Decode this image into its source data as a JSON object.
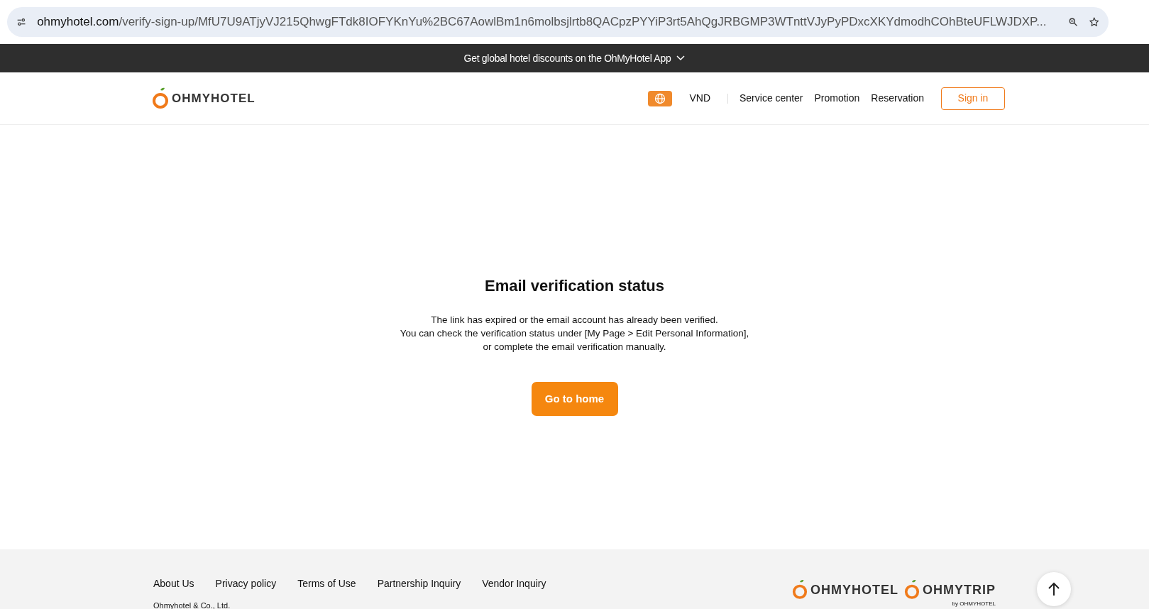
{
  "browser": {
    "url_host": "ohmyhotel.com",
    "url_path": "/verify-sign-up/MfU7U9ATjyVJ215QhwgFTdk8IOFYKnYu%2BC67AowlBm1n6molbsjlrtb8QACpzPYYiP3rt5AhQgJRBGMP3WTnttVJyPyPDxcXKYdmodhCOhBteUFLWJDXP..."
  },
  "promo_banner": {
    "text": "Get global hotel discounts on the OhMyHotel App"
  },
  "header": {
    "logo": "OHMYHOTEL",
    "currency": "VND",
    "nav": [
      "Service center",
      "Promotion",
      "Reservation"
    ],
    "sign_in": "Sign in"
  },
  "main": {
    "title": "Email verification status",
    "message_lines": [
      "The link has expired or the email account has already been verified.",
      "You can check the verification status under [My Page > Edit Personal Information],",
      "or complete the email verification manually."
    ],
    "button": "Go to home"
  },
  "footer": {
    "links": [
      "About Us",
      "Privacy policy",
      "Terms of Use",
      "Partnership Inquiry",
      "Vendor Inquiry"
    ],
    "company": "Ohmyhotel & Co., Ltd.",
    "logos": [
      {
        "name": "OHMYHOTEL"
      },
      {
        "name": "OHMYTRIP",
        "byline": "by OHMYHOTEL"
      }
    ]
  }
}
